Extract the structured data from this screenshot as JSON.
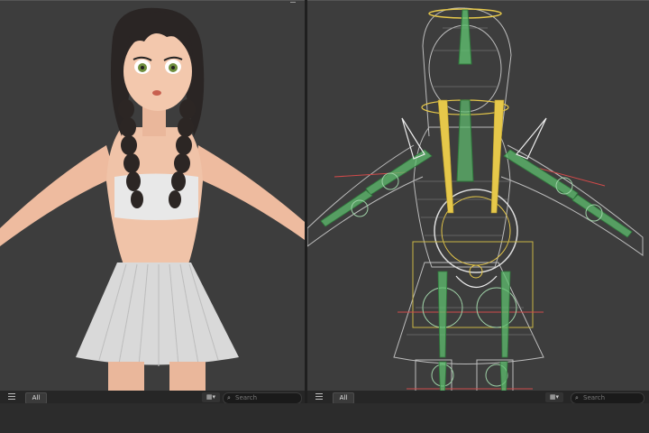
{
  "left_panel": {
    "filter_label": "All",
    "search_placeholder": "Search",
    "view_toggle_icon": "grid-icon"
  },
  "right_panel": {
    "filter_label": "All",
    "search_placeholder": "Search",
    "view_toggle_icon": "grid-icon"
  },
  "colors": {
    "viewport_bg": "#3d3d3d",
    "skin": "#f0c3a8",
    "skirt": "#d9d9d9",
    "hair": "#2a2524",
    "bone_green": "#5fbf6f",
    "bone_yellow": "#e6c84a",
    "control_red": "#d04a4a"
  }
}
